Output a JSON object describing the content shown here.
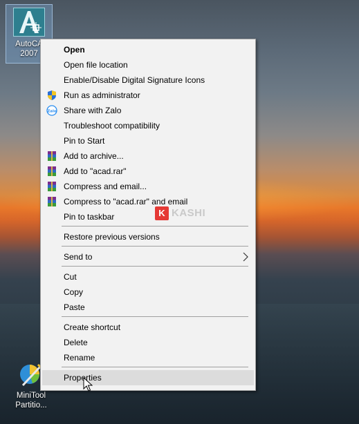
{
  "desktop": {
    "icons": [
      {
        "label_line1": "AutoCA",
        "label_line2": "2007",
        "icon": "autocad-icon"
      },
      {
        "label_line1": "MiniTool",
        "label_line2": "Partitio...",
        "icon": "minitool-icon"
      }
    ]
  },
  "context_menu": {
    "items": [
      {
        "label": "Open"
      },
      {
        "label": "Open file location"
      },
      {
        "label": "Enable/Disable Digital Signature Icons"
      },
      {
        "label": "Run as administrator",
        "icon": "shield-icon"
      },
      {
        "label": "Share with Zalo",
        "icon": "zalo-icon"
      },
      {
        "label": "Troubleshoot compatibility"
      },
      {
        "label": "Pin to Start"
      },
      {
        "label": "Add to archive...",
        "icon": "winrar-icon"
      },
      {
        "label": "Add to \"acad.rar\"",
        "icon": "winrar-icon"
      },
      {
        "label": "Compress and email...",
        "icon": "winrar-icon"
      },
      {
        "label": "Compress to \"acad.rar\" and email",
        "icon": "winrar-icon"
      },
      {
        "label": "Pin to taskbar"
      },
      {
        "label": "Restore previous versions"
      },
      {
        "label": "Send to",
        "submenu_arrow": "chevron-right-icon"
      },
      {
        "label": "Cut"
      },
      {
        "label": "Copy"
      },
      {
        "label": "Paste"
      },
      {
        "label": "Create shortcut"
      },
      {
        "label": "Delete"
      },
      {
        "label": "Rename"
      },
      {
        "label": "Properties"
      }
    ]
  },
  "watermark": {
    "badge": "K",
    "text": "KASHI"
  },
  "colors": {
    "menu_bg": "#f2f2f2",
    "hover": "#dcdcdc",
    "separator": "#a0a0a0",
    "watermark_red": "#e53935"
  }
}
